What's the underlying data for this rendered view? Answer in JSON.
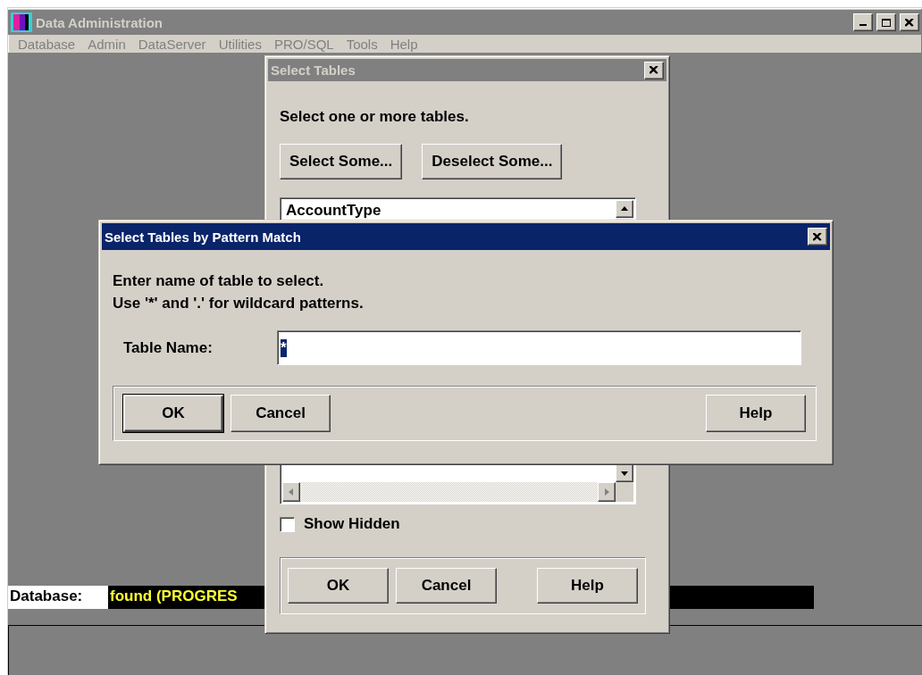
{
  "main_window": {
    "title": "Data Administration",
    "active": false,
    "menu": [
      {
        "label": "Database",
        "disabled": true
      },
      {
        "label": "Admin",
        "disabled": true
      },
      {
        "label": "DataServer",
        "disabled": true
      },
      {
        "label": "Utilities",
        "disabled": true
      },
      {
        "label": "PRO/SQL",
        "disabled": true
      },
      {
        "label": "Tools",
        "disabled": true
      },
      {
        "label": "Help",
        "disabled": true
      }
    ],
    "status": {
      "label": "Database:",
      "value": "found (PROGRES"
    }
  },
  "select_tables_dialog": {
    "title": "Select Tables",
    "active": false,
    "instruction": "Select one or more tables.",
    "buttons": [
      "Select Some...",
      "Deselect Some..."
    ],
    "table_list": [
      {
        "label": "AccountType",
        "selected": false
      }
    ],
    "show_hidden": {
      "label": "Show Hidden",
      "checked": false
    },
    "footer_buttons": [
      "OK",
      "Cancel",
      "Help"
    ]
  },
  "pattern_dialog": {
    "title": "Select Tables by Pattern Match",
    "active": true,
    "instructions": [
      "Enter name of table to select.",
      "Use '*' and '.' for wildcard patterns."
    ],
    "table_name": {
      "label": "Table Name:",
      "value": "*",
      "value_selected": true
    },
    "buttons": [
      {
        "label": "OK",
        "default": true
      },
      {
        "label": "Cancel",
        "default": false
      },
      {
        "label": "Help",
        "default": false
      }
    ]
  }
}
